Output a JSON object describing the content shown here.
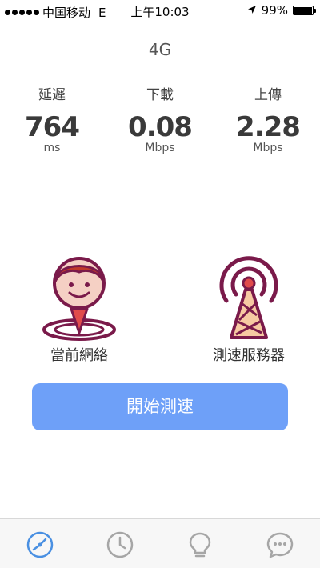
{
  "status_bar": {
    "carrier": "中国移动",
    "network_type": "E",
    "time": "上午10:03",
    "battery": "99%",
    "battery_level": 0.99
  },
  "connection": {
    "type": "4G"
  },
  "metrics": [
    {
      "label": "延遲",
      "value": "764",
      "unit": "ms"
    },
    {
      "label": "下載",
      "value": "0.08",
      "unit": "Mbps"
    },
    {
      "label": "上傳",
      "value": "2.28",
      "unit": "Mbps"
    }
  ],
  "illustrations": {
    "current_network": "當前網絡",
    "test_server": "測速服務器"
  },
  "start_button": "開始測速",
  "tabs": [
    {
      "icon": "speedometer-icon",
      "active": true
    },
    {
      "icon": "clock-icon",
      "active": false
    },
    {
      "icon": "lightbulb-icon",
      "active": false
    },
    {
      "icon": "chat-icon",
      "active": false
    }
  ],
  "colors": {
    "accent": "#6ea0f8",
    "tab_active": "#4a90e2",
    "tab_inactive": "#a6a6a6",
    "illustration": "#7a1a4a",
    "pin": "#e04b4b"
  }
}
